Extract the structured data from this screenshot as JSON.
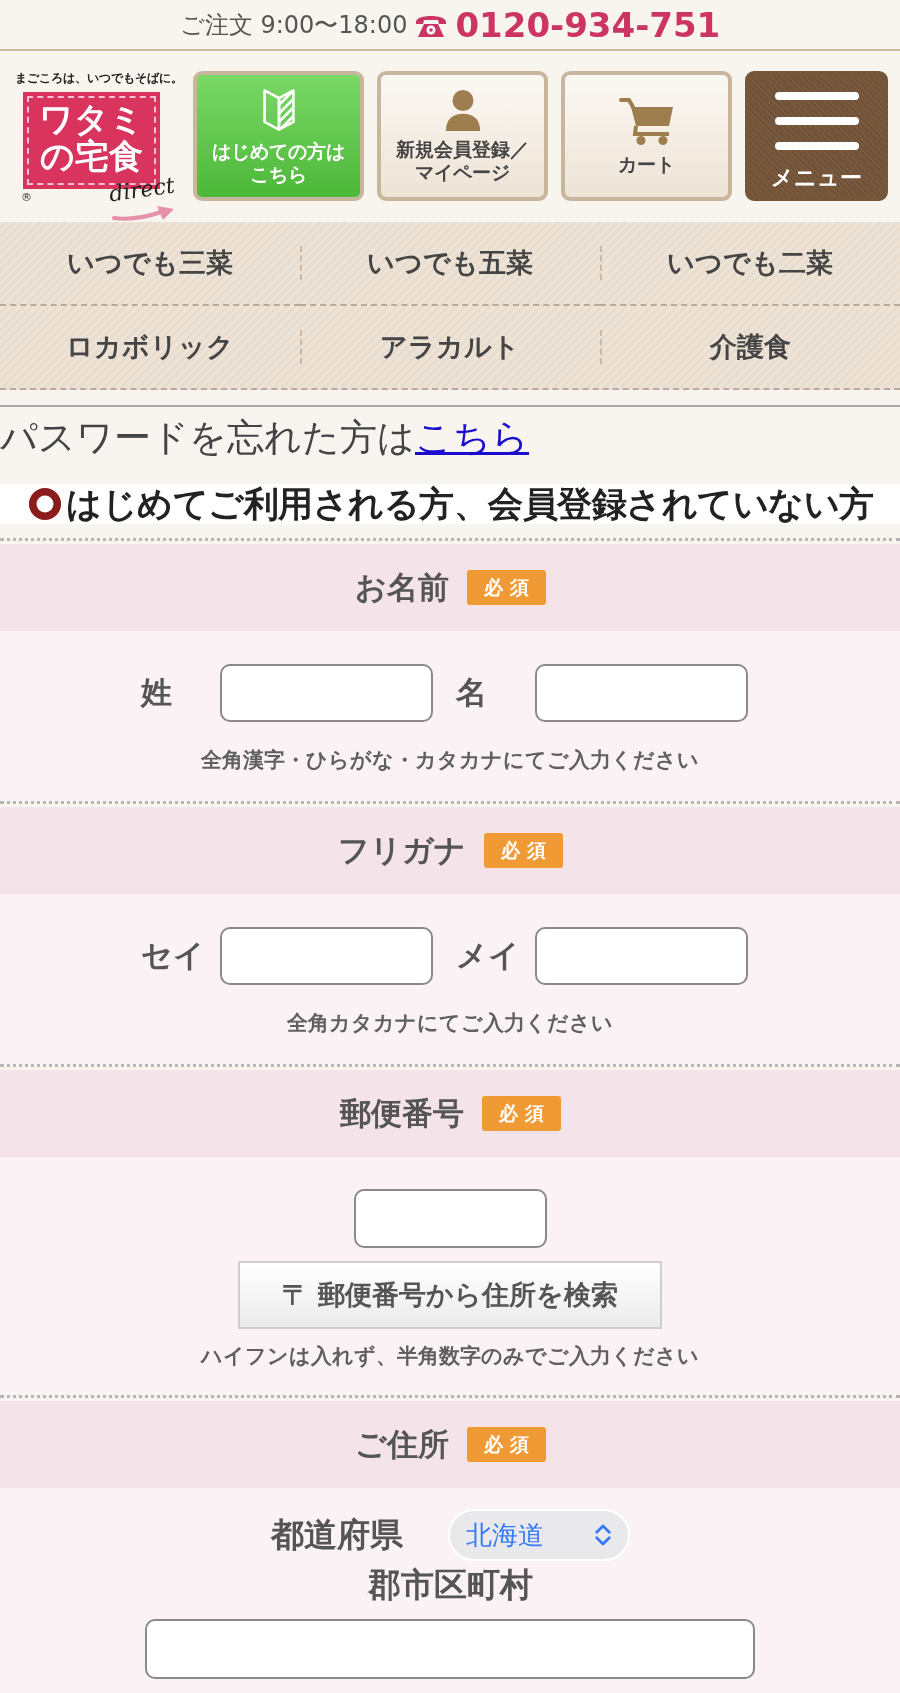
{
  "top_bar": {
    "hours": "ご注文 9:00〜18:00",
    "phone": "0120-934-751"
  },
  "logo": {
    "tagline": "まごころは、いつでもそばに。",
    "wordmark": [
      "ワタミ",
      "の宅食"
    ],
    "script": "direct",
    "registered": "®"
  },
  "header_buttons": [
    {
      "kind": "beginner",
      "label": "はじめての方はこちら"
    },
    {
      "kind": "account",
      "label": "新規会員登録／マイページ"
    },
    {
      "kind": "cart",
      "label": "カート"
    },
    {
      "kind": "menu",
      "label": "メニュー"
    }
  ],
  "category_nav": [
    {
      "label": "いつでも三菜"
    },
    {
      "label": "いつでも五菜"
    },
    {
      "label": "いつでも二菜"
    },
    {
      "label": "ロカボリック"
    },
    {
      "label": "アラカルト"
    },
    {
      "label": "介護食"
    }
  ],
  "forgot_password": {
    "text": "パスワードを忘れた方は",
    "link": "こちら"
  },
  "heading": "はじめてご利用される方、会員登録されていない方",
  "form_sections": [
    {
      "kind": "name_pair",
      "title": "お名前",
      "badge": "必須",
      "fields": [
        {
          "label": "姓"
        },
        {
          "label": "名"
        }
      ],
      "hint": "全角漢字・ひらがな・カタカナにてご入力ください"
    },
    {
      "kind": "name_pair",
      "title": "フリガナ",
      "badge": "必須",
      "fields": [
        {
          "label": "セイ"
        },
        {
          "label": "メイ"
        }
      ],
      "hint": "全角カタカナにてご入力ください"
    },
    {
      "kind": "postal",
      "title": "郵便番号",
      "badge": "必須",
      "button": "〒 郵便番号から住所を検索",
      "hint": "ハイフンは入れず、半角数字のみでご入力ください"
    },
    {
      "kind": "address",
      "title": "ご住所",
      "badge": "必須",
      "prefecture": {
        "label": "都道府県",
        "value": "北海道"
      },
      "city": {
        "label": "郡市区町村"
      }
    }
  ]
}
